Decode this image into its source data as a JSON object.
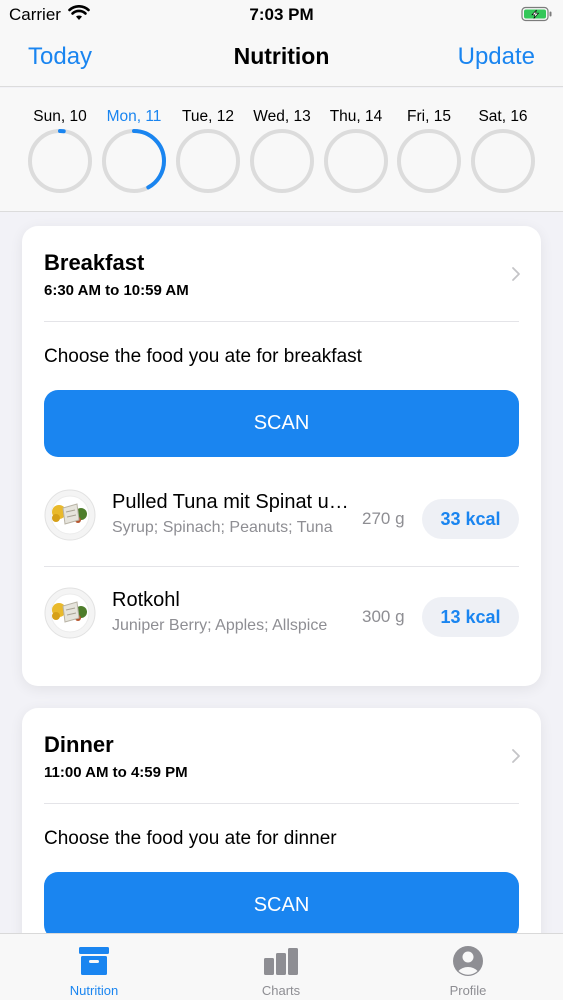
{
  "status_bar": {
    "carrier": "Carrier",
    "time": "7:03 PM"
  },
  "nav": {
    "left": "Today",
    "title": "Nutrition",
    "right": "Update"
  },
  "week": {
    "days": [
      {
        "label": "Sun, 10",
        "progress": 0.02,
        "active": false
      },
      {
        "label": "Mon, 11",
        "progress": 0.42,
        "active": true
      },
      {
        "label": "Tue, 12",
        "progress": 0,
        "active": false
      },
      {
        "label": "Wed, 13",
        "progress": 0,
        "active": false
      },
      {
        "label": "Thu, 14",
        "progress": 0,
        "active": false
      },
      {
        "label": "Fri, 15",
        "progress": 0,
        "active": false
      },
      {
        "label": "Sat, 16",
        "progress": 0,
        "active": false
      }
    ]
  },
  "meals": [
    {
      "title": "Breakfast",
      "time": "6:30 AM to 10:59 AM",
      "prompt": "Choose the food you ate for breakfast",
      "scan_label": "SCAN",
      "items": [
        {
          "name": "Pulled Tuna mit Spinat und Erdnüssen",
          "ingredients": "Syrup; Spinach; Peanuts; Tuna",
          "weight": "270 g",
          "kcal": "33 kcal"
        },
        {
          "name": "Rotkohl",
          "ingredients": "Juniper Berry; Apples; Allspice",
          "weight": "300 g",
          "kcal": "13 kcal"
        }
      ]
    },
    {
      "title": "Dinner",
      "time": "11:00 AM to 4:59 PM",
      "prompt": "Choose the food you ate for dinner",
      "scan_label": "SCAN",
      "items": []
    }
  ],
  "tabs": [
    {
      "label": "Nutrition",
      "icon": "archive-box-icon",
      "active": true
    },
    {
      "label": "Charts",
      "icon": "bar-chart-icon",
      "active": false
    },
    {
      "label": "Profile",
      "icon": "person-circle-icon",
      "active": false
    }
  ],
  "colors": {
    "accent": "#1a85f0",
    "ring_track": "#dcdcdc",
    "secondary_text": "#8e8e93",
    "battery": "#34c759"
  }
}
